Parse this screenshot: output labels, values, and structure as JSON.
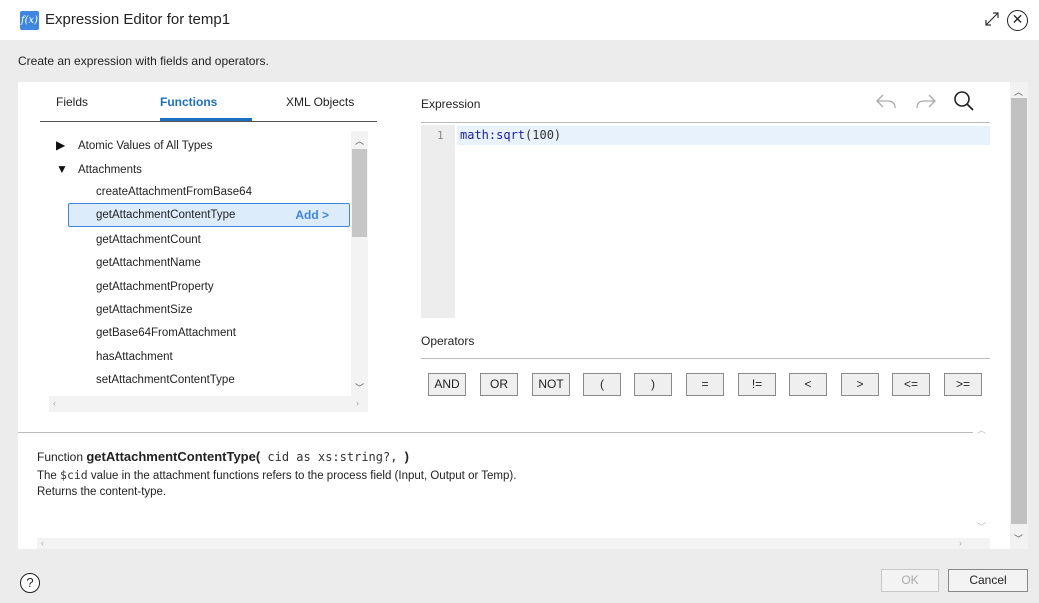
{
  "window": {
    "title": "Expression Editor for temp1",
    "app_icon_text": "f(x)",
    "subtitle": "Create an expression with fields and operators."
  },
  "tabs": [
    {
      "label": "Fields",
      "active": false
    },
    {
      "label": "Functions",
      "active": true
    },
    {
      "label": "XML Objects",
      "active": false
    }
  ],
  "tree": {
    "groups": [
      {
        "label": "Atomic Values of All Types",
        "expanded": false
      },
      {
        "label": "Attachments",
        "expanded": true
      }
    ],
    "items": [
      "createAttachmentFromBase64",
      "getAttachmentContentType",
      "getAttachmentCount",
      "getAttachmentName",
      "getAttachmentProperty",
      "getAttachmentSize",
      "getBase64FromAttachment",
      "hasAttachment",
      "setAttachmentContentType"
    ],
    "selected_item": "getAttachmentContentType",
    "add_label": "Add >"
  },
  "expression": {
    "label": "Expression",
    "line_number": "1",
    "code_fn": "math:sqrt",
    "code_args": "(100)"
  },
  "operators": {
    "label": "Operators",
    "buttons": [
      "AND",
      "OR",
      "NOT",
      "(",
      ")",
      "=",
      "!=",
      "<",
      ">",
      "<=",
      ">="
    ]
  },
  "description": {
    "prefix": "Function ",
    "function_name": "getAttachmentContentType(",
    "signature": " cid as xs:string?, ",
    "signature_close": ")",
    "line2_pre": "The ",
    "line2_var": "$cid",
    "line2_post": " value in the attachment functions refers to the process field (Input, Output or Temp).",
    "line3": "Returns the content-type."
  },
  "footer": {
    "help_label": "?",
    "ok_label": "OK",
    "ok_enabled": false,
    "cancel_label": "Cancel"
  },
  "colors": {
    "accent": "#1d6fbf",
    "selection_bg": "#dcecfb",
    "selection_border": "#3f86de"
  },
  "icons": [
    "expand-icon",
    "close-icon",
    "undo-icon",
    "redo-icon",
    "search-icon",
    "help-icon"
  ]
}
